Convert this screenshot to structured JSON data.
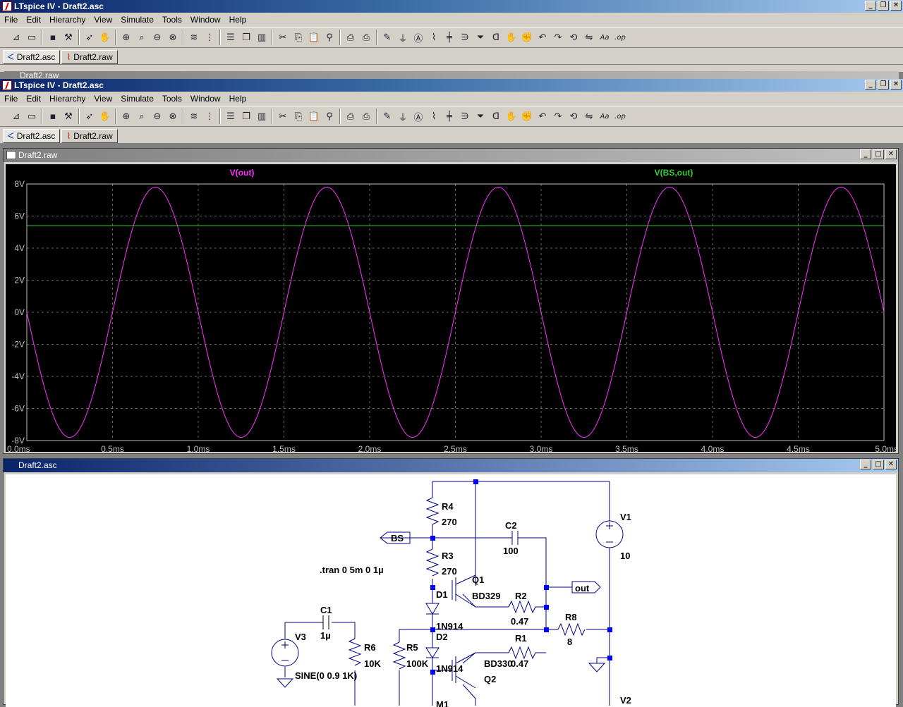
{
  "app": {
    "title": "LTspice IV - Draft2.asc",
    "menu": [
      "File",
      "Edit",
      "Hierarchy",
      "View",
      "Simulate",
      "Tools",
      "Window",
      "Help"
    ],
    "tabs": [
      {
        "label": "Draft2.asc",
        "active": true
      },
      {
        "label": "Draft2.raw",
        "active": false
      }
    ],
    "toolbar_icons": [
      "new-schematic-icon",
      "open-icon",
      "save-icon",
      "control-panel-icon",
      "run-icon",
      "halt-icon",
      "zoom-in-icon",
      "zoom-pan-icon",
      "zoom-out-icon",
      "zoom-full-icon",
      "autorange-icon",
      "grid-icon",
      "tile-horizontal-icon",
      "cascade-icon",
      "tile-vertical-icon",
      "cut-icon",
      "copy-icon",
      "paste-icon",
      "find-icon",
      "print-preview-icon",
      "print-icon",
      "wire-icon",
      "ground-icon",
      "label-icon",
      "resistor-icon",
      "capacitor-icon",
      "inductor-icon",
      "diode-icon",
      "component-icon",
      "move-icon",
      "drag-icon",
      "undo-icon",
      "redo-icon",
      "rotate-icon",
      "mirror-icon",
      "text-icon",
      "spice-directive-icon"
    ],
    "ghost_child_title": "Draft2.raw"
  },
  "plot_window": {
    "title": "Draft2.raw",
    "traces": [
      {
        "label": "V(out)",
        "color": "#ff33ff"
      },
      {
        "label": "V(BS,out)",
        "color": "#33cc33"
      }
    ],
    "x_ticks": [
      "0.0ms",
      "0.5ms",
      "1.0ms",
      "1.5ms",
      "2.0ms",
      "2.5ms",
      "3.0ms",
      "3.5ms",
      "4.0ms",
      "4.5ms",
      "5.0ms"
    ],
    "y_ticks": [
      "8V",
      "6V",
      "4V",
      "2V",
      "0V",
      "-2V",
      "-4V",
      "-6V",
      "-8V"
    ]
  },
  "chart_data": {
    "type": "line",
    "xlabel": "",
    "ylabel": "",
    "xlim": [
      0,
      5
    ],
    "ylim": [
      -8,
      8
    ],
    "x_unit": "ms",
    "y_unit": "V",
    "grid": true,
    "legend_placement": "top",
    "series": [
      {
        "name": "V(out)",
        "color": "#ff33ff",
        "kind": "sine",
        "amplitude": 7.8,
        "frequency_khz": 1,
        "phase": "negative-sine",
        "x": [
          0,
          0.25,
          0.5,
          0.75,
          1.0,
          1.25,
          1.5,
          1.75,
          2.0,
          2.25,
          2.5,
          2.75,
          3.0,
          3.25,
          3.5,
          3.75,
          4.0,
          4.25,
          4.5,
          4.75,
          5.0
        ],
        "y": [
          0,
          -7.8,
          0,
          7.8,
          0,
          -7.8,
          0,
          7.8,
          0,
          -7.8,
          0,
          7.8,
          0,
          -7.8,
          0,
          7.8,
          0,
          -7.8,
          0,
          7.8,
          0
        ]
      },
      {
        "name": "V(BS,out)",
        "color": "#33cc33",
        "x": [
          0,
          5
        ],
        "y": [
          5.4,
          5.4
        ]
      }
    ]
  },
  "schematic_window": {
    "title": "Draft2.asc",
    "labels": {
      "R4": "R4",
      "R4v": "270",
      "R3": "R3",
      "R3v": "270",
      "C2": "C2",
      "C2v": "100",
      "V1": "V1",
      "V1v": "10",
      "BS": "BS",
      "tran": ".tran 0 5m 0 1µ",
      "Q1": "Q1",
      "Q1v": "BD329",
      "out": "out",
      "D1": "D1",
      "R2": "R2",
      "R2v": "0.47",
      "C1": "C1",
      "C1v": "1µ",
      "D1v": "1N914",
      "R8": "R8",
      "R8v": "8",
      "V3": "V3",
      "D2": "D2",
      "R1": "R1",
      "R1v": "0.47",
      "R6": "R6",
      "R6v": "10K",
      "R5": "R5",
      "R5v": "100K",
      "D2v": "1N914",
      "Q2v": "BD330",
      "V3v": "SINE(0 0.9 1K)",
      "Q2": "Q2",
      "M1": "M1",
      "V2": "V2"
    }
  }
}
